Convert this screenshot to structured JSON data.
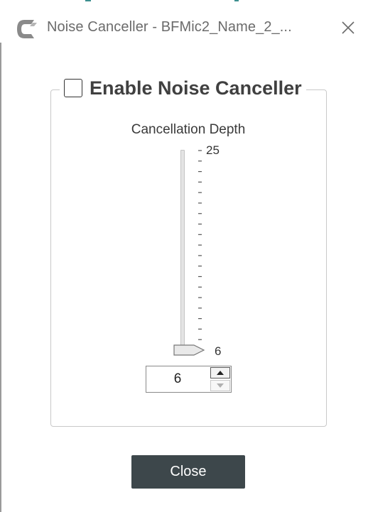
{
  "window": {
    "title": "Noise Canceller - BFMic2_Name_2_...",
    "app_icon": "app-logo-c-icon",
    "close_icon": "close-icon"
  },
  "group": {
    "enable_label": "Enable Noise Canceller",
    "enabled": false
  },
  "depth": {
    "label": "Cancellation Depth",
    "max_label": "25",
    "min_label": "6",
    "min": 6,
    "max": 25,
    "value": "6"
  },
  "footer": {
    "close_label": "Close"
  },
  "colors": {
    "button_bg": "#3d474b",
    "title_text": "#6b6b6b",
    "accent": "#3c8f8f"
  }
}
